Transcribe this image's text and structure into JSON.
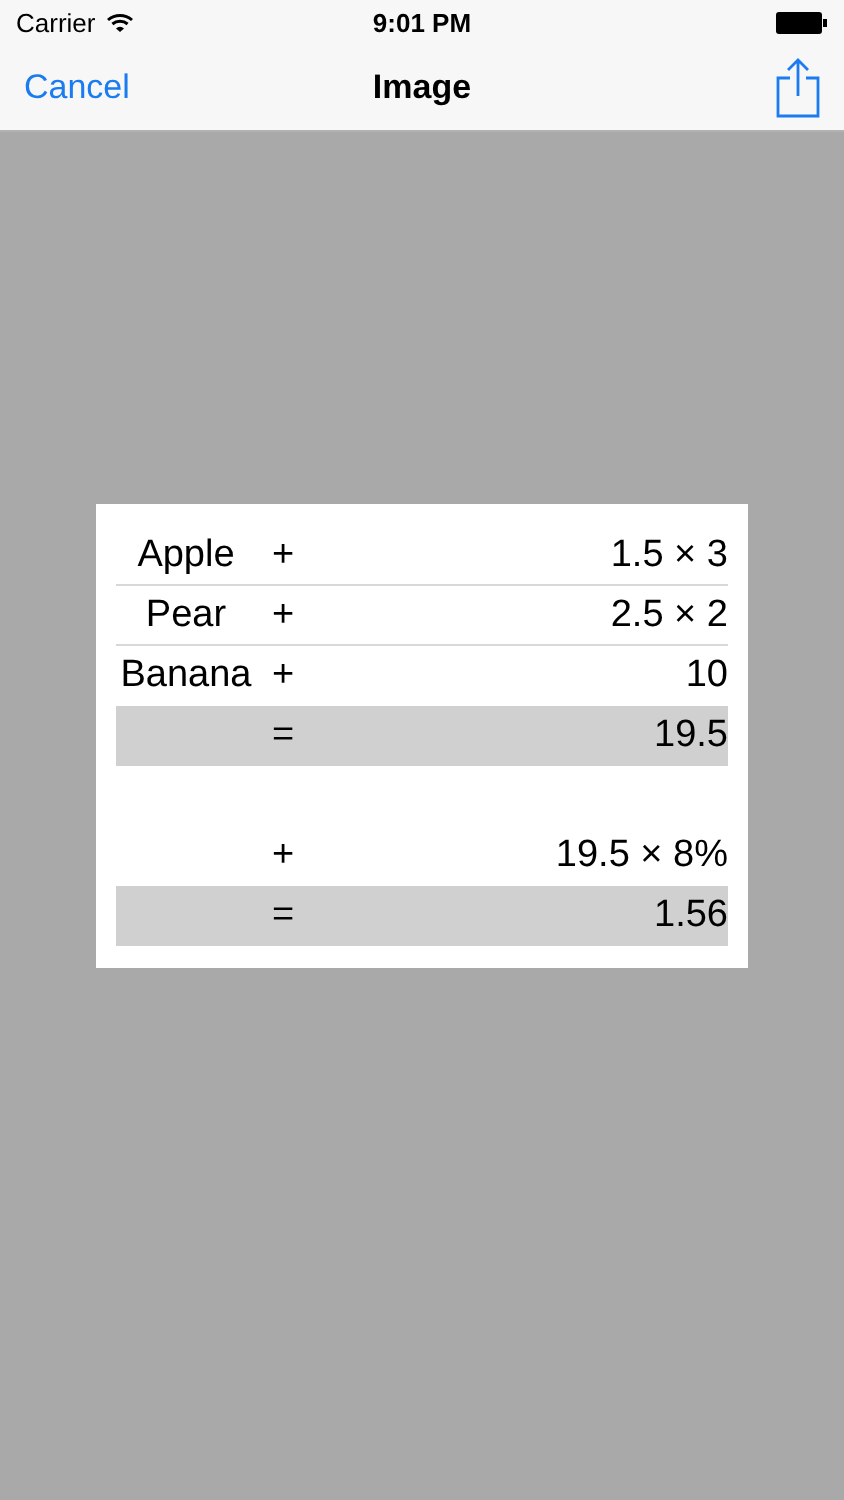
{
  "status_bar": {
    "carrier": "Carrier",
    "time": "9:01 PM"
  },
  "nav_bar": {
    "cancel": "Cancel",
    "title": "Image"
  },
  "rows": [
    {
      "kind": "item",
      "label": "Apple",
      "op": "+",
      "value": "1.5 × 3"
    },
    {
      "kind": "item",
      "label": "Pear",
      "op": "+",
      "value": "2.5 × 2"
    },
    {
      "kind": "item",
      "label": "Banana",
      "op": "+",
      "value": "10"
    },
    {
      "kind": "total",
      "op": "=",
      "value": "19.5"
    },
    {
      "kind": "spacer"
    },
    {
      "kind": "item",
      "op": "+",
      "value": "19.5 × 8%"
    },
    {
      "kind": "total",
      "op": "=",
      "value": "1.56"
    }
  ]
}
